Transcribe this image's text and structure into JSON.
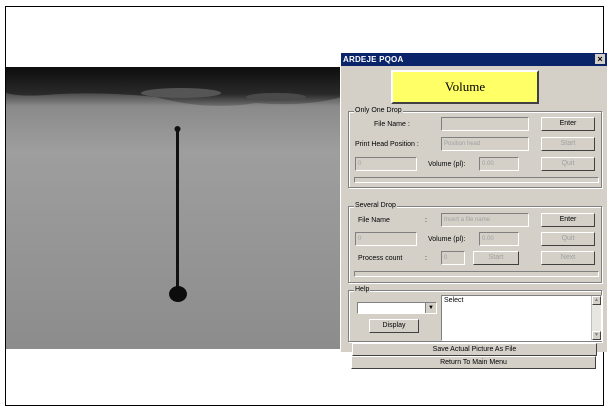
{
  "window": {
    "title": "ARDEJE PQOA",
    "close_glyph": "×"
  },
  "volume_button": "Volume",
  "only_one_drop": {
    "group_label": "Only One Drop",
    "file_name_label": "File Name :",
    "file_name_value": "",
    "enter_label": "Enter",
    "print_head_label": "Print Head Position :",
    "print_head_placeholder": "Position head",
    "start_label": "Start",
    "counter_value": "0",
    "volume_label": "Volume (pl):",
    "volume_value": "0.00",
    "quit_label": "Quit"
  },
  "several_drop": {
    "group_label": "Several Drop",
    "file_name_label": "File Name",
    "colon": ":",
    "file_name_placeholder": "Insert a file name",
    "enter_label": "Enter",
    "counter_value": "0",
    "volume_label": "Volume (pl):",
    "volume_value": "0.00",
    "quit_label": "Quit",
    "process_label": "Process count",
    "process_colon": ":",
    "process_value": "0",
    "start_label": "Start",
    "next_label": "Next"
  },
  "help": {
    "group_label": "Help",
    "combo_value": "",
    "display_label": "Display",
    "text": "Select"
  },
  "save_label": "Save Actual Picture As File",
  "return_label": "Return To Main Menu",
  "colors": {
    "title_bar": "#0a246a",
    "volume_button": "#ffff66",
    "panel": "#d4d0c8"
  }
}
